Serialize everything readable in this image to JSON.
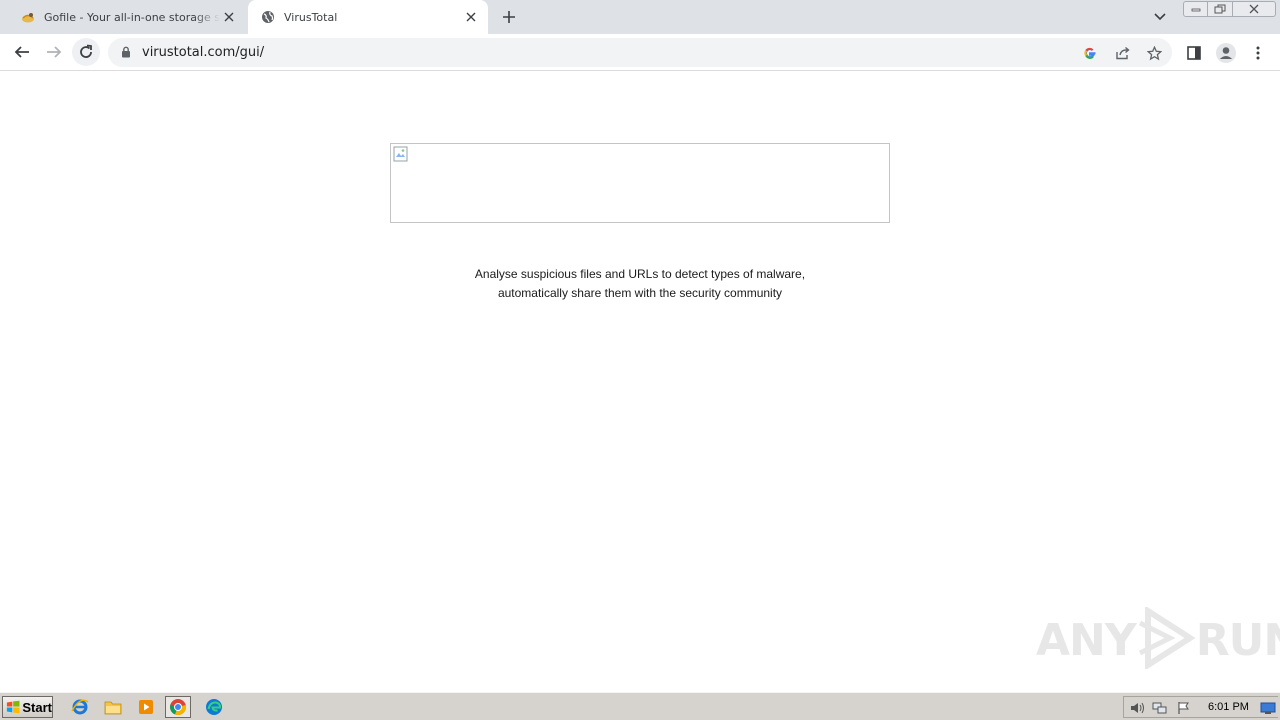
{
  "browser": {
    "tabs": [
      {
        "title": "Gofile - Your all-in-one storage solution",
        "active": false,
        "icon": "gofile-squirrel-icon"
      },
      {
        "title": "VirusTotal",
        "active": true,
        "icon": "globe-icon"
      }
    ],
    "url": "virustotal.com/gui/"
  },
  "page": {
    "logo_alt_text": "",
    "tagline_line1": "Analyse suspicious files and URLs to detect types of malware,",
    "tagline_line2": "automatically share them with the security community"
  },
  "watermark": {
    "text_left": "ANY",
    "text_right": "RUN"
  },
  "taskbar": {
    "start_label": "Start",
    "apps": [
      "ie-icon",
      "explorer-icon",
      "media-player-icon",
      "chrome-icon",
      "edge-icon"
    ],
    "clock": "6:01 PM"
  },
  "colors": {
    "tabstrip": "#dee1e6",
    "omnibox": "#f1f3f4",
    "taskbar": "#d6d3ce"
  }
}
